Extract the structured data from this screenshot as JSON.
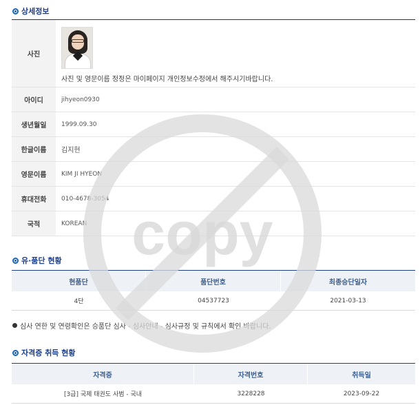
{
  "detail": {
    "title": "상세정보",
    "photo_label": "사진",
    "photo_note": "사진 및 영문이름 정정은 마이페이지 개인정보수정에서 해주시기바랍니다.",
    "rows": [
      {
        "label": "아이디",
        "value": "jihyeon0930"
      },
      {
        "label": "생년월일",
        "value": "1999.09.30"
      },
      {
        "label": "한글이름",
        "value": "김지현"
      },
      {
        "label": "영문이름",
        "value": "KIM JI HYEON"
      },
      {
        "label": "휴대전화",
        "value": "010-4678-3054"
      },
      {
        "label": "국적",
        "value": "KOREAN"
      }
    ]
  },
  "dan": {
    "title": "유·품단 현황",
    "headers": [
      "현품단",
      "품단번호",
      "최종승단일자"
    ],
    "rows": [
      [
        "4단",
        "04537723",
        "2021-03-13"
      ]
    ]
  },
  "notice": "심사 연한 및 연령확인은 승품단 심사 - 심사안내 - 심사규정 및 규칙에서 확인 바랍니다.",
  "cert": {
    "title": "자격증 취득 현황",
    "headers": [
      "자격증",
      "자격번호",
      "취득일"
    ],
    "rows": [
      [
        "[3급] 국제 태권도 사범 - 국내",
        "3228228",
        "2023-09-22"
      ]
    ]
  },
  "watermark": {
    "text": "copy",
    "color": "#d9d9d9"
  },
  "colors": {
    "accent": "#1565c0",
    "title": "#1f3f8a",
    "header_bg": "#eef2f7",
    "label_bg": "#f3f3f3"
  }
}
